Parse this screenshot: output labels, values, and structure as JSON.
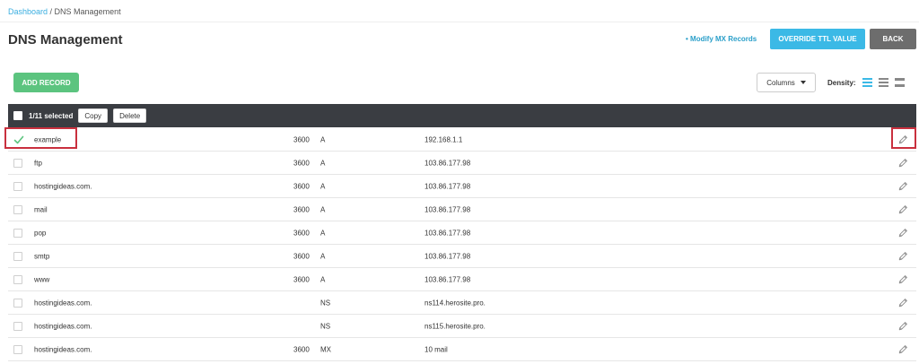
{
  "breadcrumb": {
    "home": "Dashboard",
    "separator": " / ",
    "current": "DNS Management"
  },
  "page_title": "DNS Management",
  "header_actions": {
    "modify_mx": "• Modify MX Records",
    "override_ttl": "OVERRIDE TTL VALUE",
    "back": "BACK"
  },
  "toolbar": {
    "add_record": "ADD RECORD",
    "columns": "Columns",
    "density_label": "Density:"
  },
  "table_toolbar": {
    "selected": "1/11 selected",
    "copy": "Copy",
    "delete": "Delete"
  },
  "records": [
    {
      "name": "example",
      "ttl": "3600",
      "type": "A",
      "value": "192.168.1.1",
      "selected": true
    },
    {
      "name": "ftp",
      "ttl": "3600",
      "type": "A",
      "value": "103.86.177.98",
      "selected": false
    },
    {
      "name": "hostingideas.com.",
      "ttl": "3600",
      "type": "A",
      "value": "103.86.177.98",
      "selected": false
    },
    {
      "name": "mail",
      "ttl": "3600",
      "type": "A",
      "value": "103.86.177.98",
      "selected": false
    },
    {
      "name": "pop",
      "ttl": "3600",
      "type": "A",
      "value": "103.86.177.98",
      "selected": false
    },
    {
      "name": "smtp",
      "ttl": "3600",
      "type": "A",
      "value": "103.86.177.98",
      "selected": false
    },
    {
      "name": "www",
      "ttl": "3600",
      "type": "A",
      "value": "103.86.177.98",
      "selected": false
    },
    {
      "name": "hostingideas.com.",
      "ttl": "",
      "type": "NS",
      "value": "ns114.herosite.pro.",
      "selected": false
    },
    {
      "name": "hostingideas.com.",
      "ttl": "",
      "type": "NS",
      "value": "ns115.herosite.pro.",
      "selected": false
    },
    {
      "name": "hostingideas.com.",
      "ttl": "3600",
      "type": "MX",
      "value": "10 mail",
      "selected": false
    }
  ],
  "icons": {
    "row_edit": "pencil-icon",
    "row_selected": "checkmark-icon",
    "columns_caret": "caret-down-icon",
    "density": [
      "density-compact-icon",
      "density-standard-icon",
      "density-comfortable-icon"
    ]
  },
  "colors": {
    "primary": "#3bb9e6",
    "success": "#5cc47f",
    "toolbar_dark": "#3a3d42",
    "back_button": "#6d6d6d",
    "highlight": "#c9303e",
    "check": "#5cc47f"
  }
}
